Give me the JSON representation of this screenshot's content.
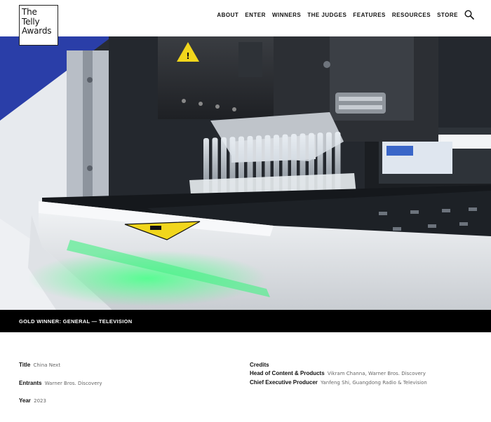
{
  "header": {
    "logo_lines": [
      "The",
      "Telly",
      "Awards"
    ],
    "nav": [
      "ABOUT",
      "ENTER",
      "WINNERS",
      "THE JUDGES",
      "FEATURES",
      "RESOURCES",
      "STORE"
    ],
    "search_icon": "search-icon"
  },
  "award": {
    "label": "GOLD WINNER: GENERAL — TELEVISION"
  },
  "details": {
    "title_label": "Title",
    "title_value": "China Next",
    "entrants_label": "Entrants",
    "entrants_value": "Warner Bros. Discovery",
    "year_label": "Year",
    "year_value": "2023"
  },
  "credits": {
    "heading": "Credits",
    "items": [
      {
        "role": "Head of Content & Products",
        "name": "Vikram Channa, Warner Bros. Discovery"
      },
      {
        "role": "Chief Executive Producer",
        "name": "Yanfeng Shi, Guangdong Radio & Television"
      }
    ]
  },
  "colors": {
    "award_bar": "#000000",
    "header_bg": "#ffffff",
    "accent_blue": "#2a3ea8",
    "glow_green": "#3ee07a"
  }
}
